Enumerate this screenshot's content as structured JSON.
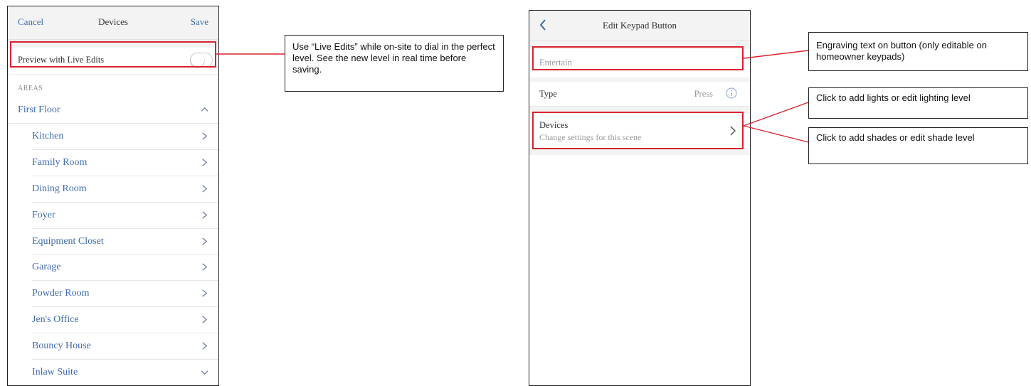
{
  "left_screen": {
    "nav": {
      "cancel_label": "Cancel",
      "title": "Devices",
      "save_label": "Save"
    },
    "preview": {
      "label": "Preview with Live Edits",
      "toggle_on": false
    },
    "areas_header": "AREAS",
    "floor": {
      "label": "First Floor",
      "expanded": true
    },
    "areas": [
      {
        "label": "Kitchen",
        "icon": "chevron-right-icon"
      },
      {
        "label": "Family Room",
        "icon": "chevron-right-icon"
      },
      {
        "label": "Dining Room",
        "icon": "chevron-right-icon"
      },
      {
        "label": "Foyer",
        "icon": "chevron-right-icon"
      },
      {
        "label": "Equipment Closet",
        "icon": "chevron-right-icon"
      },
      {
        "label": "Garage",
        "icon": "chevron-right-icon"
      },
      {
        "label": "Powder Room",
        "icon": "chevron-right-icon"
      },
      {
        "label": "Jen's Office",
        "icon": "chevron-right-icon"
      },
      {
        "label": "Bouncy House",
        "icon": "chevron-right-icon"
      },
      {
        "label": "Inlaw Suite",
        "icon": "chevron-down-icon"
      }
    ]
  },
  "right_screen": {
    "nav": {
      "title": "Edit Keypad Button"
    },
    "engraving": {
      "placeholder": "Entertain"
    },
    "type_row": {
      "label": "Type",
      "value": "Press"
    },
    "devices_row": {
      "title": "Devices",
      "subtitle": "Change settings for this scene"
    }
  },
  "callouts": {
    "live_edits": "Use “Live Edits” while on-site to dial in the perfect level. See the new level in real time before saving.",
    "engraving": "Engraving text on button (only editable on homeowner keypads)",
    "lights": "Click to add lights or edit lighting level",
    "shades": "Click to add shades or edit shade level"
  },
  "colors": {
    "accent": "#3f6cae",
    "highlight": "#d9232e",
    "text": "#333333",
    "muted": "#9a9a9a"
  }
}
